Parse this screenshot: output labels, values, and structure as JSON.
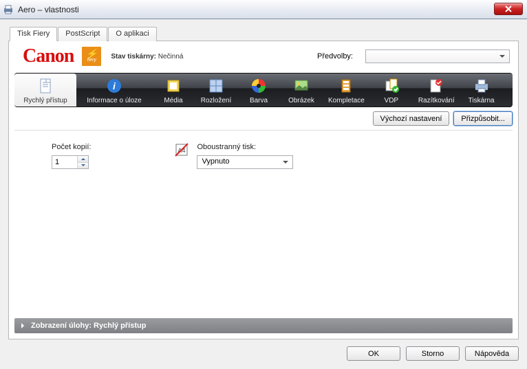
{
  "window": {
    "title": "Aero – vlastnosti"
  },
  "mainTabs": {
    "items": [
      {
        "label": "Tisk Fiery"
      },
      {
        "label": "PostScript"
      },
      {
        "label": "O aplikaci"
      }
    ]
  },
  "brand": {
    "logoText": "Canon",
    "statusLabel": "Stav tiskárny:",
    "statusValue": "Nečinná",
    "presetsLabel": "Předvolby:",
    "presetsValue": ""
  },
  "toolbar": {
    "items": [
      {
        "label": "Rychlý přístup",
        "icon": "document-icon"
      },
      {
        "label": "Informace o úloze",
        "icon": "info-icon"
      },
      {
        "label": "Média",
        "icon": "media-icon"
      },
      {
        "label": "Rozložení",
        "icon": "layout-icon"
      },
      {
        "label": "Barva",
        "icon": "color-icon"
      },
      {
        "label": "Obrázek",
        "icon": "image-icon"
      },
      {
        "label": "Kompletace",
        "icon": "finishing-icon"
      },
      {
        "label": "VDP",
        "icon": "vdp-icon"
      },
      {
        "label": "Razítkování",
        "icon": "stamp-icon"
      },
      {
        "label": "Tiskárna",
        "icon": "printer-icon"
      }
    ]
  },
  "subButtons": {
    "defaults": "Výchozí nastavení",
    "customize": "Přizpůsobit..."
  },
  "fields": {
    "copiesLabel": "Počet kopií:",
    "copiesValue": "1",
    "duplexLabel": "Oboustranný tisk:",
    "duplexValue": "Vypnuto"
  },
  "statusStrip": {
    "text": "Zobrazení úlohy: Rychlý přístup"
  },
  "bottom": {
    "ok": "OK",
    "cancel": "Storno",
    "help": "Nápověda"
  }
}
